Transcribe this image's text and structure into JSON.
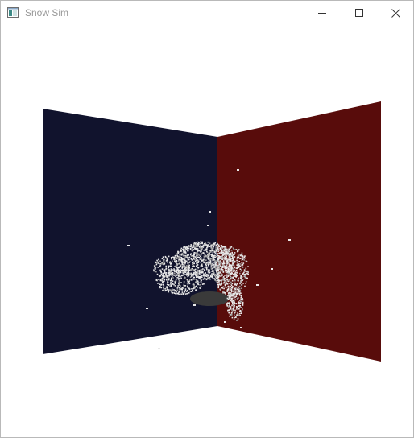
{
  "window": {
    "title": "Snow Sim"
  },
  "titlebar": {
    "app_icon": "window-app-icon",
    "buttons": [
      {
        "name": "minimize",
        "icon": "minimize-icon"
      },
      {
        "name": "maximize",
        "icon": "maximize-icon"
      },
      {
        "name": "close",
        "icon": "close-icon"
      }
    ]
  },
  "scene": {
    "left_wall_color": "#11132d",
    "right_wall_color": "#580c0b",
    "floor_color": "#ffffff",
    "sphere_color": "#3a3a3a",
    "snow_color": "#e8e8e8"
  }
}
